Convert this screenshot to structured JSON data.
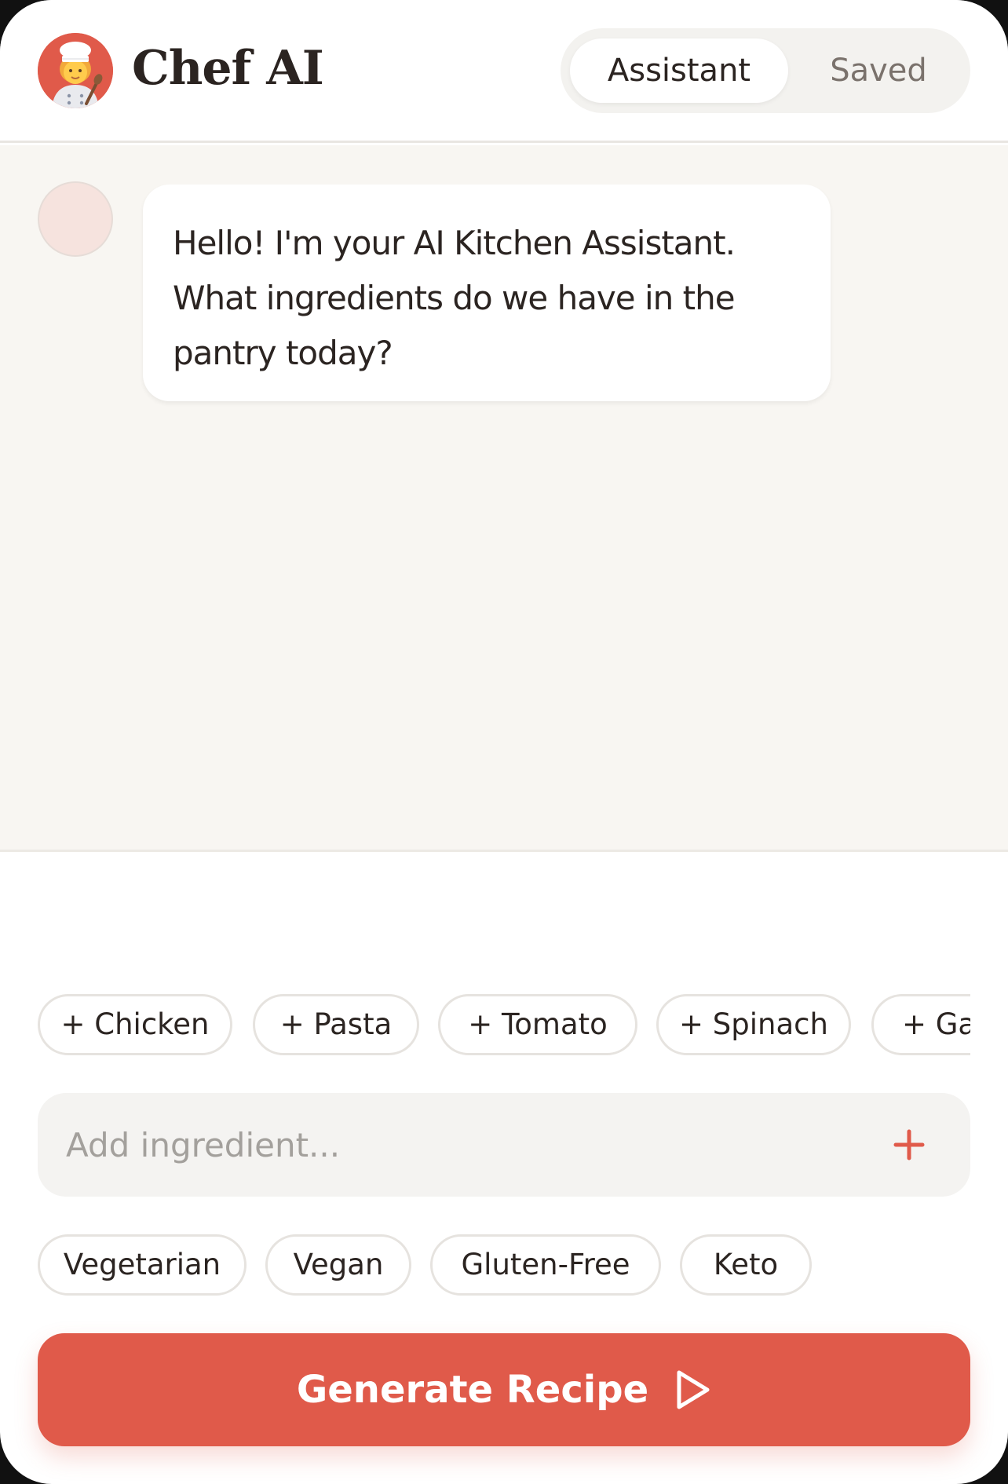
{
  "header": {
    "app_title": "Chef AI",
    "tabs": [
      {
        "label": "Assistant",
        "active": true
      },
      {
        "label": "Saved",
        "active": false
      }
    ]
  },
  "chat": {
    "messages": [
      {
        "sender": "bot",
        "text": "Hello! I'm your AI Kitchen Assistant. What ingredients do we have in the pantry today?"
      }
    ]
  },
  "quick_ingredients": [
    "+ Chicken",
    "+ Pasta",
    "+ Tomato",
    "+ Spinach",
    "+ Gar"
  ],
  "input": {
    "placeholder": "Add ingredient..."
  },
  "diet_filters": [
    "Vegetarian",
    "Vegan",
    "Gluten-Free",
    "Keto"
  ],
  "generate": {
    "label": "Generate Recipe"
  },
  "colors": {
    "accent": "#e05a4a",
    "background": "#f8f6f2",
    "text": "#2b2421"
  },
  "icons": {
    "logo": "chef-avatar-icon",
    "add": "plus-icon",
    "generate": "play-icon"
  }
}
